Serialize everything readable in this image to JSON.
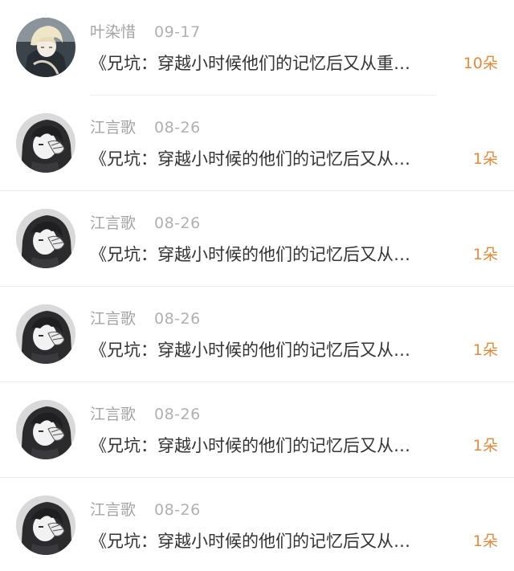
{
  "comments": [
    {
      "user": "叶染惜",
      "date": "09-17",
      "title": "《兄坑：穿越小时候他们的记忆后又从重…",
      "count": "10朵",
      "avatar_icon": "anime-avatar-icon-light-hair"
    },
    {
      "user": "江言歌",
      "date": "08-26",
      "title": "《兄坑：穿越小时候的他们的记忆后又从…",
      "count": "1朵",
      "avatar_icon": "anime-avatar-icon-dark-hair"
    },
    {
      "user": "江言歌",
      "date": "08-26",
      "title": "《兄坑：穿越小时候的他们的记忆后又从…",
      "count": "1朵",
      "avatar_icon": "anime-avatar-icon-dark-hair"
    },
    {
      "user": "江言歌",
      "date": "08-26",
      "title": "《兄坑：穿越小时候的他们的记忆后又从…",
      "count": "1朵",
      "avatar_icon": "anime-avatar-icon-dark-hair"
    },
    {
      "user": "江言歌",
      "date": "08-26",
      "title": "《兄坑：穿越小时候的他们的记忆后又从…",
      "count": "1朵",
      "avatar_icon": "anime-avatar-icon-dark-hair"
    },
    {
      "user": "江言歌",
      "date": "08-26",
      "title": "《兄坑：穿越小时候的他们的记忆后又从…",
      "count": "1朵",
      "avatar_icon": "anime-avatar-icon-dark-hair"
    }
  ],
  "colors": {
    "name_text": "#a3a3a3",
    "title_text": "#333333",
    "count_accent": "#e38a3c",
    "divider": "#ececec"
  }
}
